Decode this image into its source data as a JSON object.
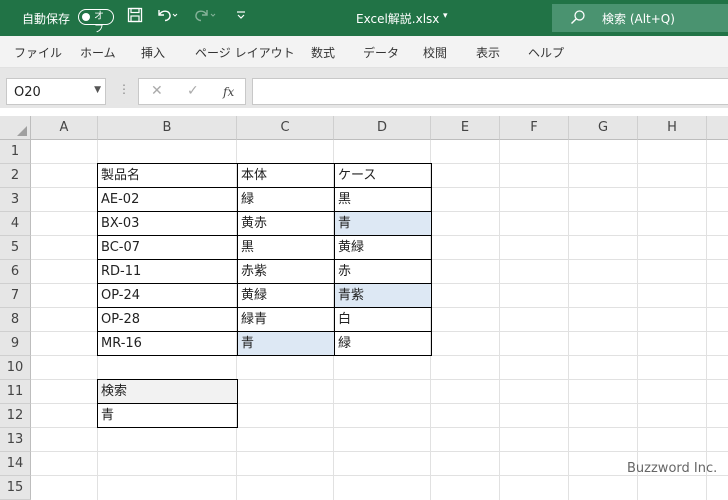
{
  "titlebar": {
    "autosave_label": "自動保存",
    "autosave_state": "オフ",
    "file_name": "Excel解説.xlsx",
    "search_label": "検索 (Alt+Q)"
  },
  "ribbon_tabs": [
    "ファイル",
    "ホーム",
    "挿入",
    "ページ レイアウト",
    "数式",
    "データ",
    "校閲",
    "表示",
    "ヘルプ"
  ],
  "formula_bar": {
    "name_box": "O20",
    "fx_label": "fx",
    "formula": ""
  },
  "columns": [
    "A",
    "B",
    "C",
    "D",
    "E",
    "F",
    "G",
    "H"
  ],
  "rows": [
    "1",
    "2",
    "3",
    "4",
    "5",
    "6",
    "7",
    "8",
    "9",
    "10",
    "11",
    "12",
    "13",
    "14",
    "15"
  ],
  "table": {
    "headers": [
      "製品名",
      "本体",
      "ケース"
    ],
    "rows": [
      [
        "AE-02",
        "緑",
        "黒"
      ],
      [
        "BX-03",
        "黄赤",
        "青"
      ],
      [
        "BC-07",
        "黒",
        "黄緑"
      ],
      [
        "RD-11",
        "赤紫",
        "赤"
      ],
      [
        "OP-24",
        "黄緑",
        "青紫"
      ],
      [
        "OP-28",
        "緑青",
        "白"
      ],
      [
        "MR-16",
        "青",
        "緑"
      ]
    ]
  },
  "search_box": {
    "label": "検索",
    "value": "青"
  },
  "highlight_color": "#dde8f4",
  "accent_color": "#217346",
  "watermark": "Buzzword Inc."
}
